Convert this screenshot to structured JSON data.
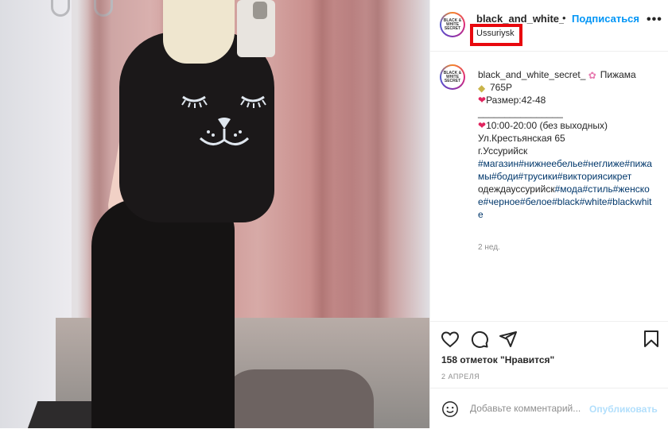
{
  "post": {
    "username": "black_and_white_secret_",
    "follow_label": "Подписаться",
    "separator": "•",
    "location": "Ussuriysk",
    "avatar_text": "BLACK & WHITE SECRET"
  },
  "caption": {
    "username": "black_and_white_secret_",
    "title": "Пижама",
    "price": "765Р",
    "size": "Размер:42-48",
    "divider": "________________",
    "hours": "10:00-20:00 (без выходных)",
    "address": "Ул.Крестьянская 65",
    "city": "г.Уссурийск",
    "tags_a": "#магазин#нижнеебелье#неглиже#пижамы#боди#трусики#викториясикрет",
    "tags_b_plain": "одеждауссурийск",
    "tags_b": "#мода#стиль#женское#черное#белое#black#white#blackwhite",
    "ago": "2 нед."
  },
  "stats": {
    "likes": "158 отметок \"Нравится\"",
    "date": "2 АПРЕЛЯ"
  },
  "comment": {
    "placeholder": "Добавьте комментарий...",
    "publish_label": "Опубликовать"
  },
  "icons": {
    "like": "heart-outline-icon",
    "comment": "comment-bubble-icon",
    "share": "paper-plane-icon",
    "save": "bookmark-icon",
    "emoji": "smiley-icon",
    "more": "more-options-icon"
  },
  "colors": {
    "accent": "#0095f6",
    "highlight_box": "#e8080e",
    "hashtag": "#00376b"
  }
}
